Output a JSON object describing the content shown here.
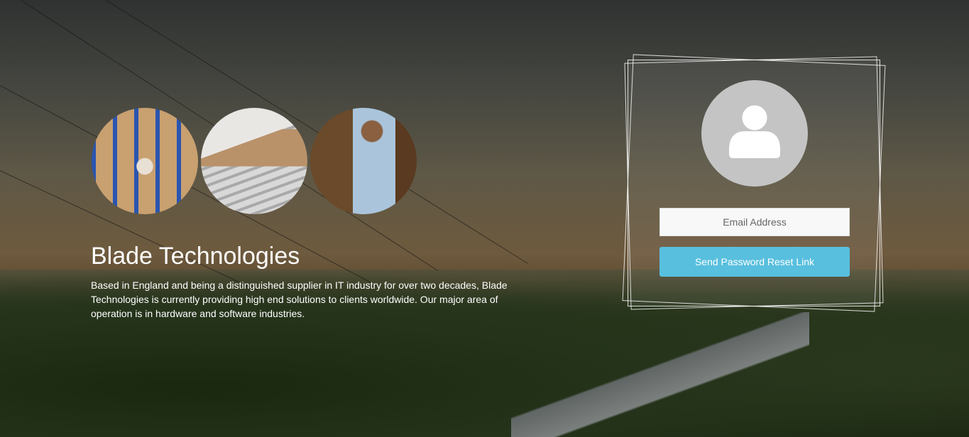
{
  "hero": {
    "images": [
      {
        "label": "warehouse-aisle"
      },
      {
        "label": "cardboard-box-conveyor"
      },
      {
        "label": "man-with-laptop-warehouse"
      }
    ],
    "title": "Blade Technologies",
    "description": "Based in England and being a distinguished supplier in IT industry for over two decades, Blade Technologies is currently providing high end solutions to clients worldwide. Our major area of operation is in hardware and software industries."
  },
  "reset_form": {
    "email_placeholder": "Email Address",
    "email_value": "",
    "submit_label": "Send Password Reset Link",
    "accent_color": "#58bfde"
  }
}
